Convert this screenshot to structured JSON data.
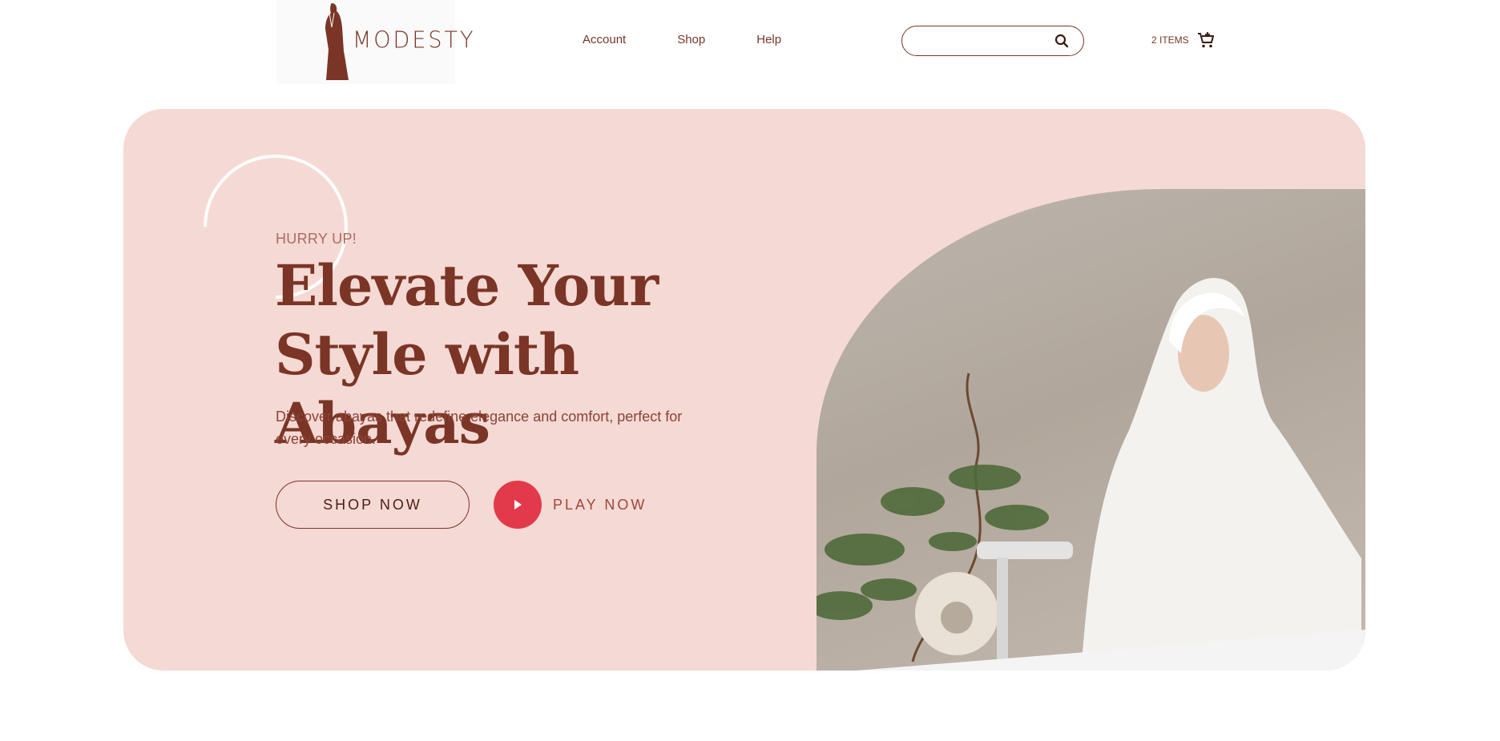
{
  "header": {
    "logo": {
      "text": "MODESTY",
      "icon": "abaya-figure-icon"
    },
    "nav": [
      {
        "label": "Account"
      },
      {
        "label": "Shop"
      },
      {
        "label": "Help"
      }
    ],
    "search": {
      "value": "",
      "placeholder": "",
      "icon": "search-icon"
    },
    "cart": {
      "label": "2 ITEMS",
      "icon": "cart-icon"
    }
  },
  "hero": {
    "eyebrow": "HURRY UP!",
    "title_line1": "Elevate Your",
    "title_line2": "Style with Abayas",
    "description": "Discover abayas that redefine elegance and comfort, perfect for every occasion.",
    "shop_button": "SHOP NOW",
    "play_button": "PLAY NOW",
    "play_icon": "play-icon",
    "image": "woman-in-white-hijab-photo"
  },
  "colors": {
    "brand": "#7a3526",
    "hero_background": "#f5d9d4",
    "play_accent": "#e23a4b",
    "page_background": "#ffffff"
  }
}
